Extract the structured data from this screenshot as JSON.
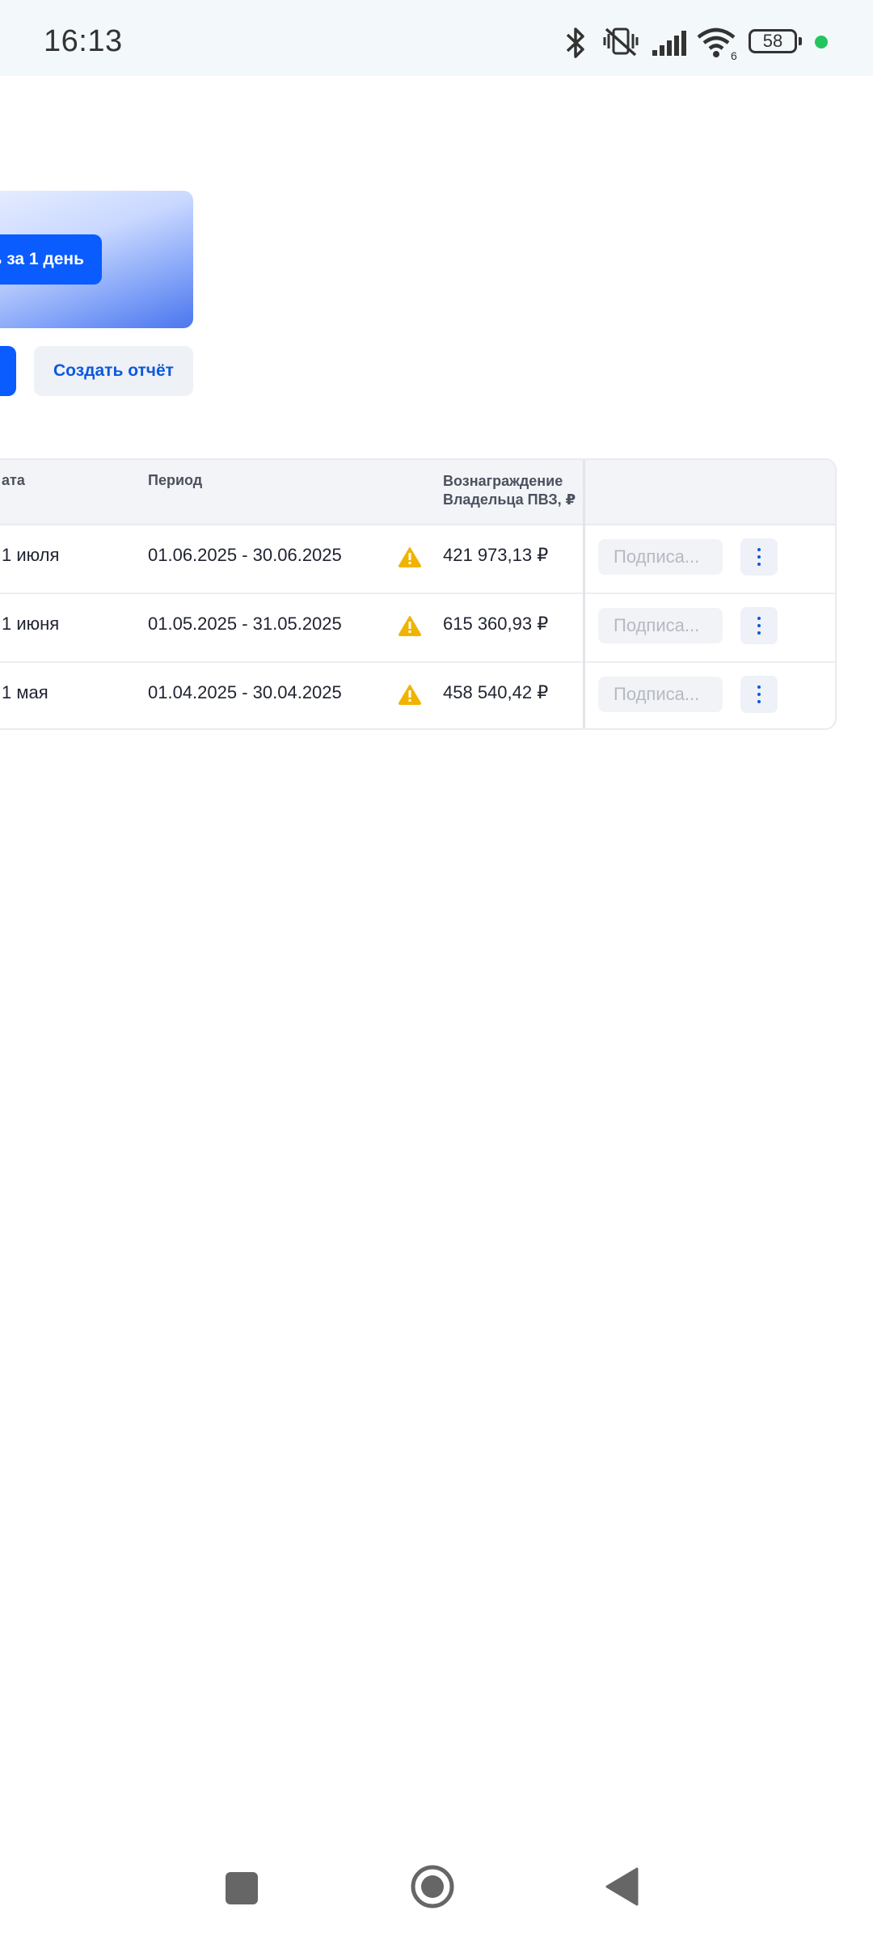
{
  "status_bar": {
    "time": "16:13",
    "battery": "58",
    "signal_badge": "6",
    "icons": [
      "bluetooth-icon",
      "vibrate-mute-icon",
      "cell-signal-icon",
      "wifi-icon",
      "battery-icon",
      "active-dot"
    ],
    "dot_color": "#22c55e"
  },
  "promo": {
    "button_label": "ь за 1 день"
  },
  "actions": {
    "create_report": "Создать отчёт"
  },
  "table": {
    "headers": {
      "date": "ата",
      "period": "Период",
      "reward": "Вознаграждение Владельца ПВЗ, ₽"
    },
    "rows": [
      {
        "date": "1 июля",
        "period": "01.06.2025 - 30.06.2025",
        "reward": "421 973,13 ₽",
        "action": "Подписа..."
      },
      {
        "date": "1 июня",
        "period": "01.05.2025 - 31.05.2025",
        "reward": "615 360,93 ₽",
        "action": "Подписа..."
      },
      {
        "date": "1 мая",
        "period": "01.04.2025 - 30.04.2025",
        "reward": "458 540,42 ₽",
        "action": "Подписа..."
      }
    ]
  },
  "colors": {
    "accent": "#0a5cff",
    "warning": "#f0b400",
    "link": "#0b59e0"
  }
}
